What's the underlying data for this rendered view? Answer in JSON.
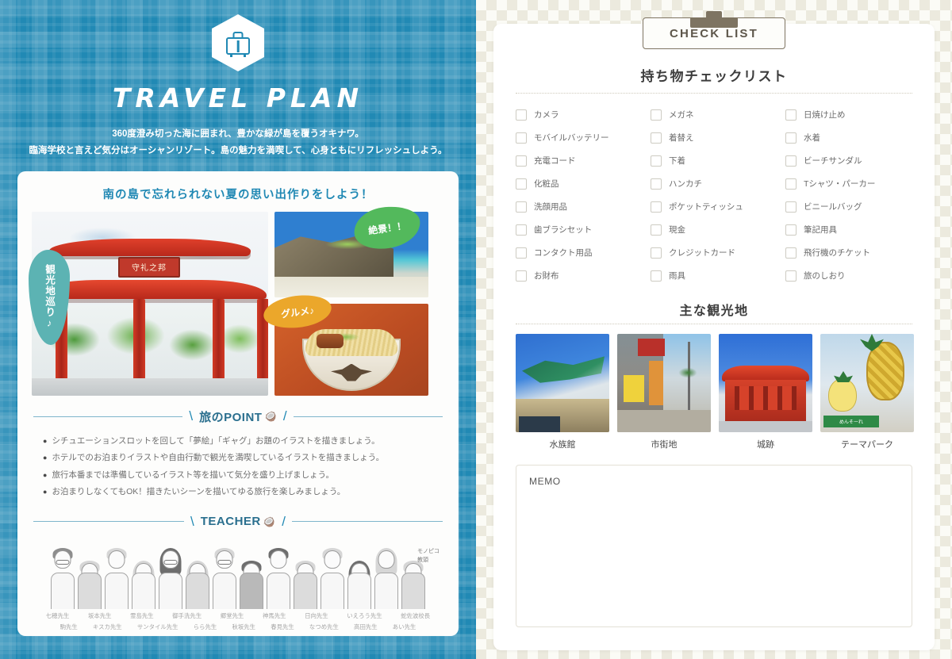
{
  "left": {
    "logo_icon": "suitcase-icon",
    "title": "TRAVEL PLAN",
    "lead_line1": "360度澄み切った海に囲まれ、豊かな緑が島を覆うオキナワ。",
    "lead_line2": "臨海学校と言えど気分はオーシャンリゾート。島の魅力を満喫して、心身ともにリフレッシュしよう。",
    "card_heading": "南の島で忘れられない夏の思い出作りをしよう！",
    "bubbles": {
      "sightseeing": "観光地巡り♪",
      "view": "絶景！！",
      "gourmet": "グルメ♪"
    },
    "point_section": {
      "title": "旅のPOINT",
      "items": [
        "シチュエーションスロットを回して「夢絵」「ギャグ」お題のイラストを描きましょう。",
        "ホテルでのお泊まりイラストや自由行動で観光を満喫しているイラストを描きましょう。",
        "旅行本番までは準備しているイラスト等を描いて気分を盛り上げましょう。",
        "お泊まりしなくてもOK！描きたいシーンを描いてゆる旅行を楽しみましょう。"
      ]
    },
    "teacher_section": {
      "title": "TEACHER",
      "note_line1": "モノピコ",
      "note_line2": "教頭",
      "names_row1": [
        "七穂先生",
        "坂本先生",
        "霊島先生",
        "御手洗先生",
        "郷堂先生",
        "神馬先生",
        "日向先生",
        "いえろう先生",
        "蛇佐波校長"
      ],
      "names_row2": [
        "駒先生",
        "キスカ先生",
        "サンタイル先生",
        "らら先生",
        "秋坂先生",
        "春見先生",
        "なつめ先生",
        "高田先生",
        "あい先生"
      ]
    }
  },
  "right": {
    "clip_label": "CHECK LIST",
    "checklist_title": "持ち物チェックリスト",
    "checklist_columns": [
      [
        "カメラ",
        "モバイルバッテリー",
        "充電コード",
        "化粧品",
        "洗顔用品",
        "歯ブラシセット",
        "コンタクト用品",
        "お財布"
      ],
      [
        "メガネ",
        "着替え",
        "下着",
        "ハンカチ",
        "ポケットティッシュ",
        "現金",
        "クレジットカード",
        "雨具"
      ],
      [
        "日焼け止め",
        "水着",
        "ビーチサンダル",
        "Tシャツ・パーカー",
        "ビニールバッグ",
        "筆記用具",
        "飛行機のチケット",
        "旅のしおり"
      ]
    ],
    "spots_title": "主な観光地",
    "spots": [
      {
        "caption": "水族館",
        "art": "aquarium"
      },
      {
        "caption": "市街地",
        "art": "city"
      },
      {
        "caption": "城跡",
        "art": "castle"
      },
      {
        "caption": "テーマパーク",
        "art": "theme-park"
      }
    ],
    "memo_label": "MEMO"
  },
  "colors": {
    "left_bg": "#2189b4",
    "accent_blue": "#2a6f8e",
    "clip_brown": "#7e7462",
    "bubble_teal": "#5cb3b3",
    "bubble_green": "#53b95c",
    "bubble_orange": "#eba72b",
    "right_bg": "#fbfbf6"
  }
}
